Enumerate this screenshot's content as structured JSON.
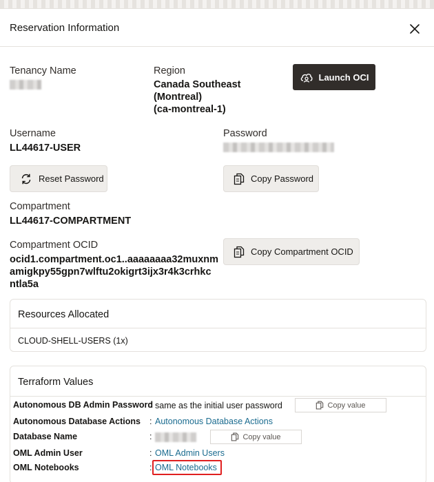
{
  "dialog": {
    "title": "Reservation Information"
  },
  "tenancy": {
    "label": "Tenancy Name"
  },
  "region": {
    "label": "Region",
    "value_line1": "Canada Southeast",
    "value_line2": "(Montreal)",
    "value_line3": "(ca-montreal-1)"
  },
  "launch_button": {
    "label": "Launch OCI"
  },
  "username": {
    "label": "Username",
    "value": "LL44617-USER"
  },
  "password": {
    "label": "Password"
  },
  "reset_button": {
    "label": "Reset Password"
  },
  "copy_password_button": {
    "label": "Copy Password"
  },
  "compartment": {
    "label": "Compartment",
    "value": "LL44617-COMPARTMENT"
  },
  "compartment_ocid": {
    "label": "Compartment OCID",
    "value_line1": "ocid1.compartment.oc1..aaaaaaaa32muxnm",
    "value_line2": "amigkpy55gpn7wlftu2okigrt3ijx3r4k3crhkc",
    "value_line3": "ntla5a"
  },
  "copy_ocid_button": {
    "label": "Copy Compartment OCID"
  },
  "resources": {
    "title": "Resources Allocated",
    "item": "CLOUD-SHELL-USERS (1x)"
  },
  "terraform": {
    "title": "Terraform Values",
    "colon": ":",
    "copy_label": "Copy value",
    "rows": [
      {
        "label": "Autonomous DB Admin Password",
        "value": "same as the initial user password"
      },
      {
        "label": "Autonomous Database Actions",
        "value": "Autonomous Database Actions"
      },
      {
        "label": "Database Name",
        "value": ""
      },
      {
        "label": "OML Admin User",
        "value": "OML Admin Users"
      },
      {
        "label": "OML Notebooks",
        "value": "OML Notebooks"
      }
    ]
  },
  "colors": {
    "link": "#1a6b8f",
    "primary_button": "#312d2a",
    "highlight": "#e01f1f"
  }
}
